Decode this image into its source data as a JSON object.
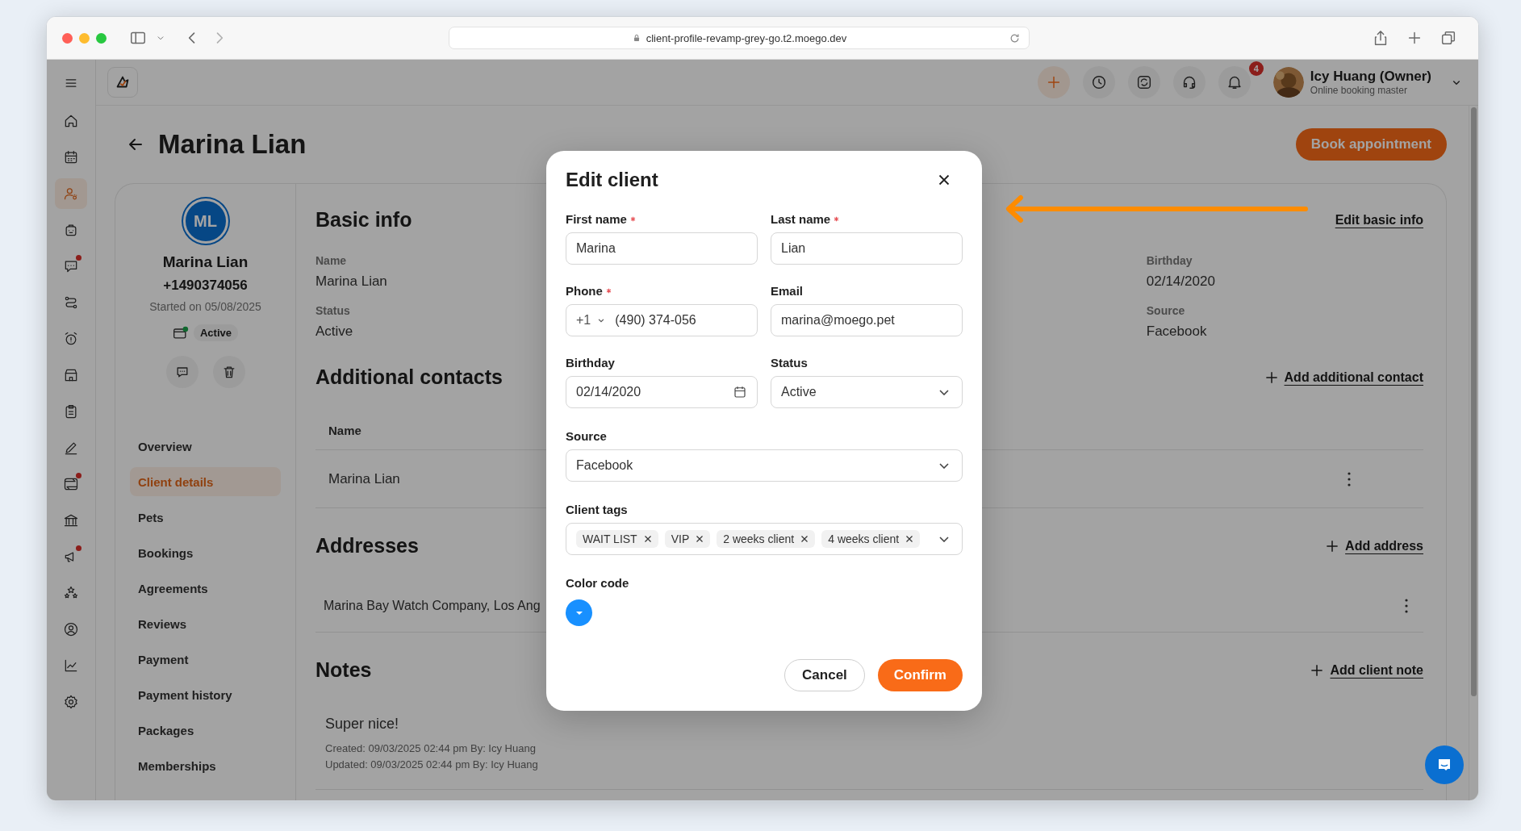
{
  "browser": {
    "url": "client-profile-revamp-grey-go.t2.moego.dev"
  },
  "nav_rail": {
    "items": [
      {
        "kind": "home",
        "selected": false,
        "dot": false
      },
      {
        "kind": "calendar",
        "selected": false,
        "dot": false
      },
      {
        "kind": "clients",
        "selected": true,
        "dot": false
      },
      {
        "kind": "bag",
        "selected": false,
        "dot": false
      },
      {
        "kind": "chat",
        "selected": false,
        "dot": true
      },
      {
        "kind": "route",
        "selected": false,
        "dot": false
      },
      {
        "kind": "alarm",
        "selected": false,
        "dot": false
      },
      {
        "kind": "store",
        "selected": false,
        "dot": false
      },
      {
        "kind": "clipboard",
        "selected": false,
        "dot": false
      },
      {
        "kind": "pen",
        "selected": false,
        "dot": false
      },
      {
        "kind": "swap",
        "selected": false,
        "dot": true
      },
      {
        "kind": "bank",
        "selected": false,
        "dot": false
      },
      {
        "kind": "megaphone",
        "selected": false,
        "dot": true
      },
      {
        "kind": "stars",
        "selected": false,
        "dot": false
      },
      {
        "kind": "user",
        "selected": false,
        "dot": false
      },
      {
        "kind": "chart",
        "selected": false,
        "dot": false
      },
      {
        "kind": "gear",
        "selected": false,
        "dot": false
      }
    ]
  },
  "header": {
    "notifications": "4",
    "user": {
      "name": "Icy Huang (Owner)",
      "role": "Online booking master"
    }
  },
  "page": {
    "title": "Marina Lian",
    "book_button": "Book appointment"
  },
  "profile": {
    "initials": "ML",
    "name": "Marina Lian",
    "phone": "+1490374056",
    "started": "Started on 05/08/2025",
    "status": "Active",
    "menu": [
      {
        "label": "Overview",
        "selected": false
      },
      {
        "label": "Client details",
        "selected": true
      },
      {
        "label": "Pets",
        "selected": false
      },
      {
        "label": "Bookings",
        "selected": false
      },
      {
        "label": "Agreements",
        "selected": false
      },
      {
        "label": "Reviews",
        "selected": false
      },
      {
        "label": "Payment",
        "selected": false
      },
      {
        "label": "Payment history",
        "selected": false
      },
      {
        "label": "Packages",
        "selected": false
      },
      {
        "label": "Memberships",
        "selected": false
      }
    ]
  },
  "basic_info": {
    "title": "Basic info",
    "action": "Edit basic info",
    "columns": [
      {
        "fields": [
          {
            "label": "Name",
            "value": "Marina Lian"
          },
          {
            "label": "Status",
            "value": "Active"
          }
        ]
      },
      {
        "fields": [
          {
            "label": "Birthday",
            "value": "02/14/2020"
          },
          {
            "label": "Source",
            "value": "Facebook"
          }
        ]
      }
    ]
  },
  "additional_contacts": {
    "title": "Additional contacts",
    "action": "Add additional contact",
    "columns": [
      "Name"
    ],
    "rows": [
      [
        "Marina Lian"
      ]
    ]
  },
  "addresses": {
    "title": "Addresses",
    "action": "Add address",
    "items": [
      "Marina Bay Watch Company, Los Ang"
    ]
  },
  "notes": {
    "title": "Notes",
    "action": "Add client note",
    "items": [
      {
        "text": "Super nice!",
        "created": "Created: 09/03/2025 02:44 pm By: Icy Huang",
        "updated": "Updated: 09/03/2025 02:44 pm By: Icy Huang"
      }
    ]
  },
  "modal": {
    "title": "Edit client",
    "fields": [
      {
        "label": "First name",
        "required": true,
        "kind": "text",
        "value": "Marina"
      },
      {
        "label": "Last name",
        "required": true,
        "kind": "text",
        "value": "Lian"
      },
      {
        "label": "Phone",
        "required": true,
        "kind": "phone",
        "prefix": "+1",
        "value": "(490) 374-056"
      },
      {
        "label": "Email",
        "required": false,
        "kind": "text",
        "value": "marina@moego.pet"
      },
      {
        "label": "Birthday",
        "required": false,
        "kind": "date",
        "value": "02/14/2020"
      },
      {
        "label": "Status",
        "required": false,
        "kind": "select",
        "value": "Active"
      }
    ],
    "source": {
      "label": "Source",
      "value": "Facebook"
    },
    "client_tags": {
      "label": "Client tags",
      "tags": [
        "WAIT LIST",
        "VIP",
        "2 weeks client",
        "4 weeks client"
      ]
    },
    "color_code": {
      "label": "Color code",
      "color": "#1890ff"
    },
    "buttons": {
      "cancel": "Cancel",
      "confirm": "Confirm"
    }
  }
}
